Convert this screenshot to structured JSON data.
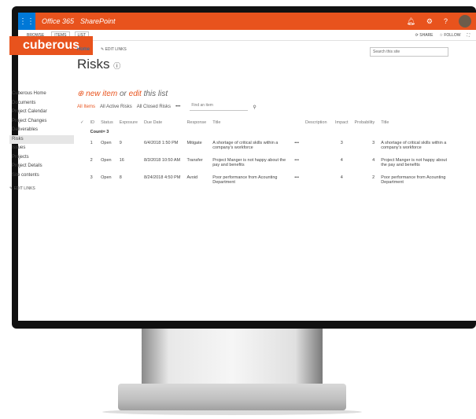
{
  "suite": {
    "app": "Office 365",
    "product": "SharePoint"
  },
  "ribbon": {
    "tabs": [
      "BROWSE",
      "ITEMS",
      "LIST"
    ],
    "share": "SHARE",
    "follow": "FOLLOW"
  },
  "logo": "cuberous",
  "header": {
    "home": "Home",
    "edit_links": "EDIT LINKS",
    "title": "Risks",
    "search_placeholder": "Search this site"
  },
  "nav": {
    "items": [
      "Cuberous Home",
      "Documents",
      "Project Calendar",
      "Project Changes",
      "Deliverables",
      "Risks",
      "Issues",
      "Projects",
      "Project Details",
      "Site contents"
    ],
    "selected": "Risks",
    "edit": "EDIT LINKS"
  },
  "new_item": {
    "prefix": "new item",
    "or": "or",
    "edit": "edit",
    "suffix": "this list"
  },
  "views": {
    "items": [
      "All Items",
      "All Active Risks",
      "All Closed Risks",
      "•••"
    ],
    "find": "Find an item"
  },
  "table": {
    "columns": [
      "ID",
      "Status",
      "Exposure",
      "Due Date",
      "Response",
      "Title",
      "",
      "Description",
      "Impact",
      "Probability",
      "Title"
    ],
    "count": "Count= 3",
    "rows": [
      [
        "1",
        "Open",
        "9",
        "6/4/2018 1:50 PM",
        "Mitigate",
        "A shortage of critical skills within a company's workforce",
        "•••",
        "",
        "3",
        "3",
        "A shortage of critical skills within a company's workforce"
      ],
      [
        "2",
        "Open",
        "16",
        "8/3/2018 10:50 AM",
        "Transfer",
        "Project Manger is not happy about the pay and benefits",
        "•••",
        "",
        "4",
        "4",
        "Project Manger is not happy about the pay and benefits"
      ],
      [
        "3",
        "Open",
        "8",
        "8/24/2018 4:50 PM",
        "Avoid",
        "Poor performance from Acounting Department",
        "•••",
        "",
        "4",
        "2",
        "Poor performance from Acounting Department"
      ]
    ]
  },
  "colors": {
    "accent": "#e8531d",
    "waffle": "#0078d7"
  }
}
